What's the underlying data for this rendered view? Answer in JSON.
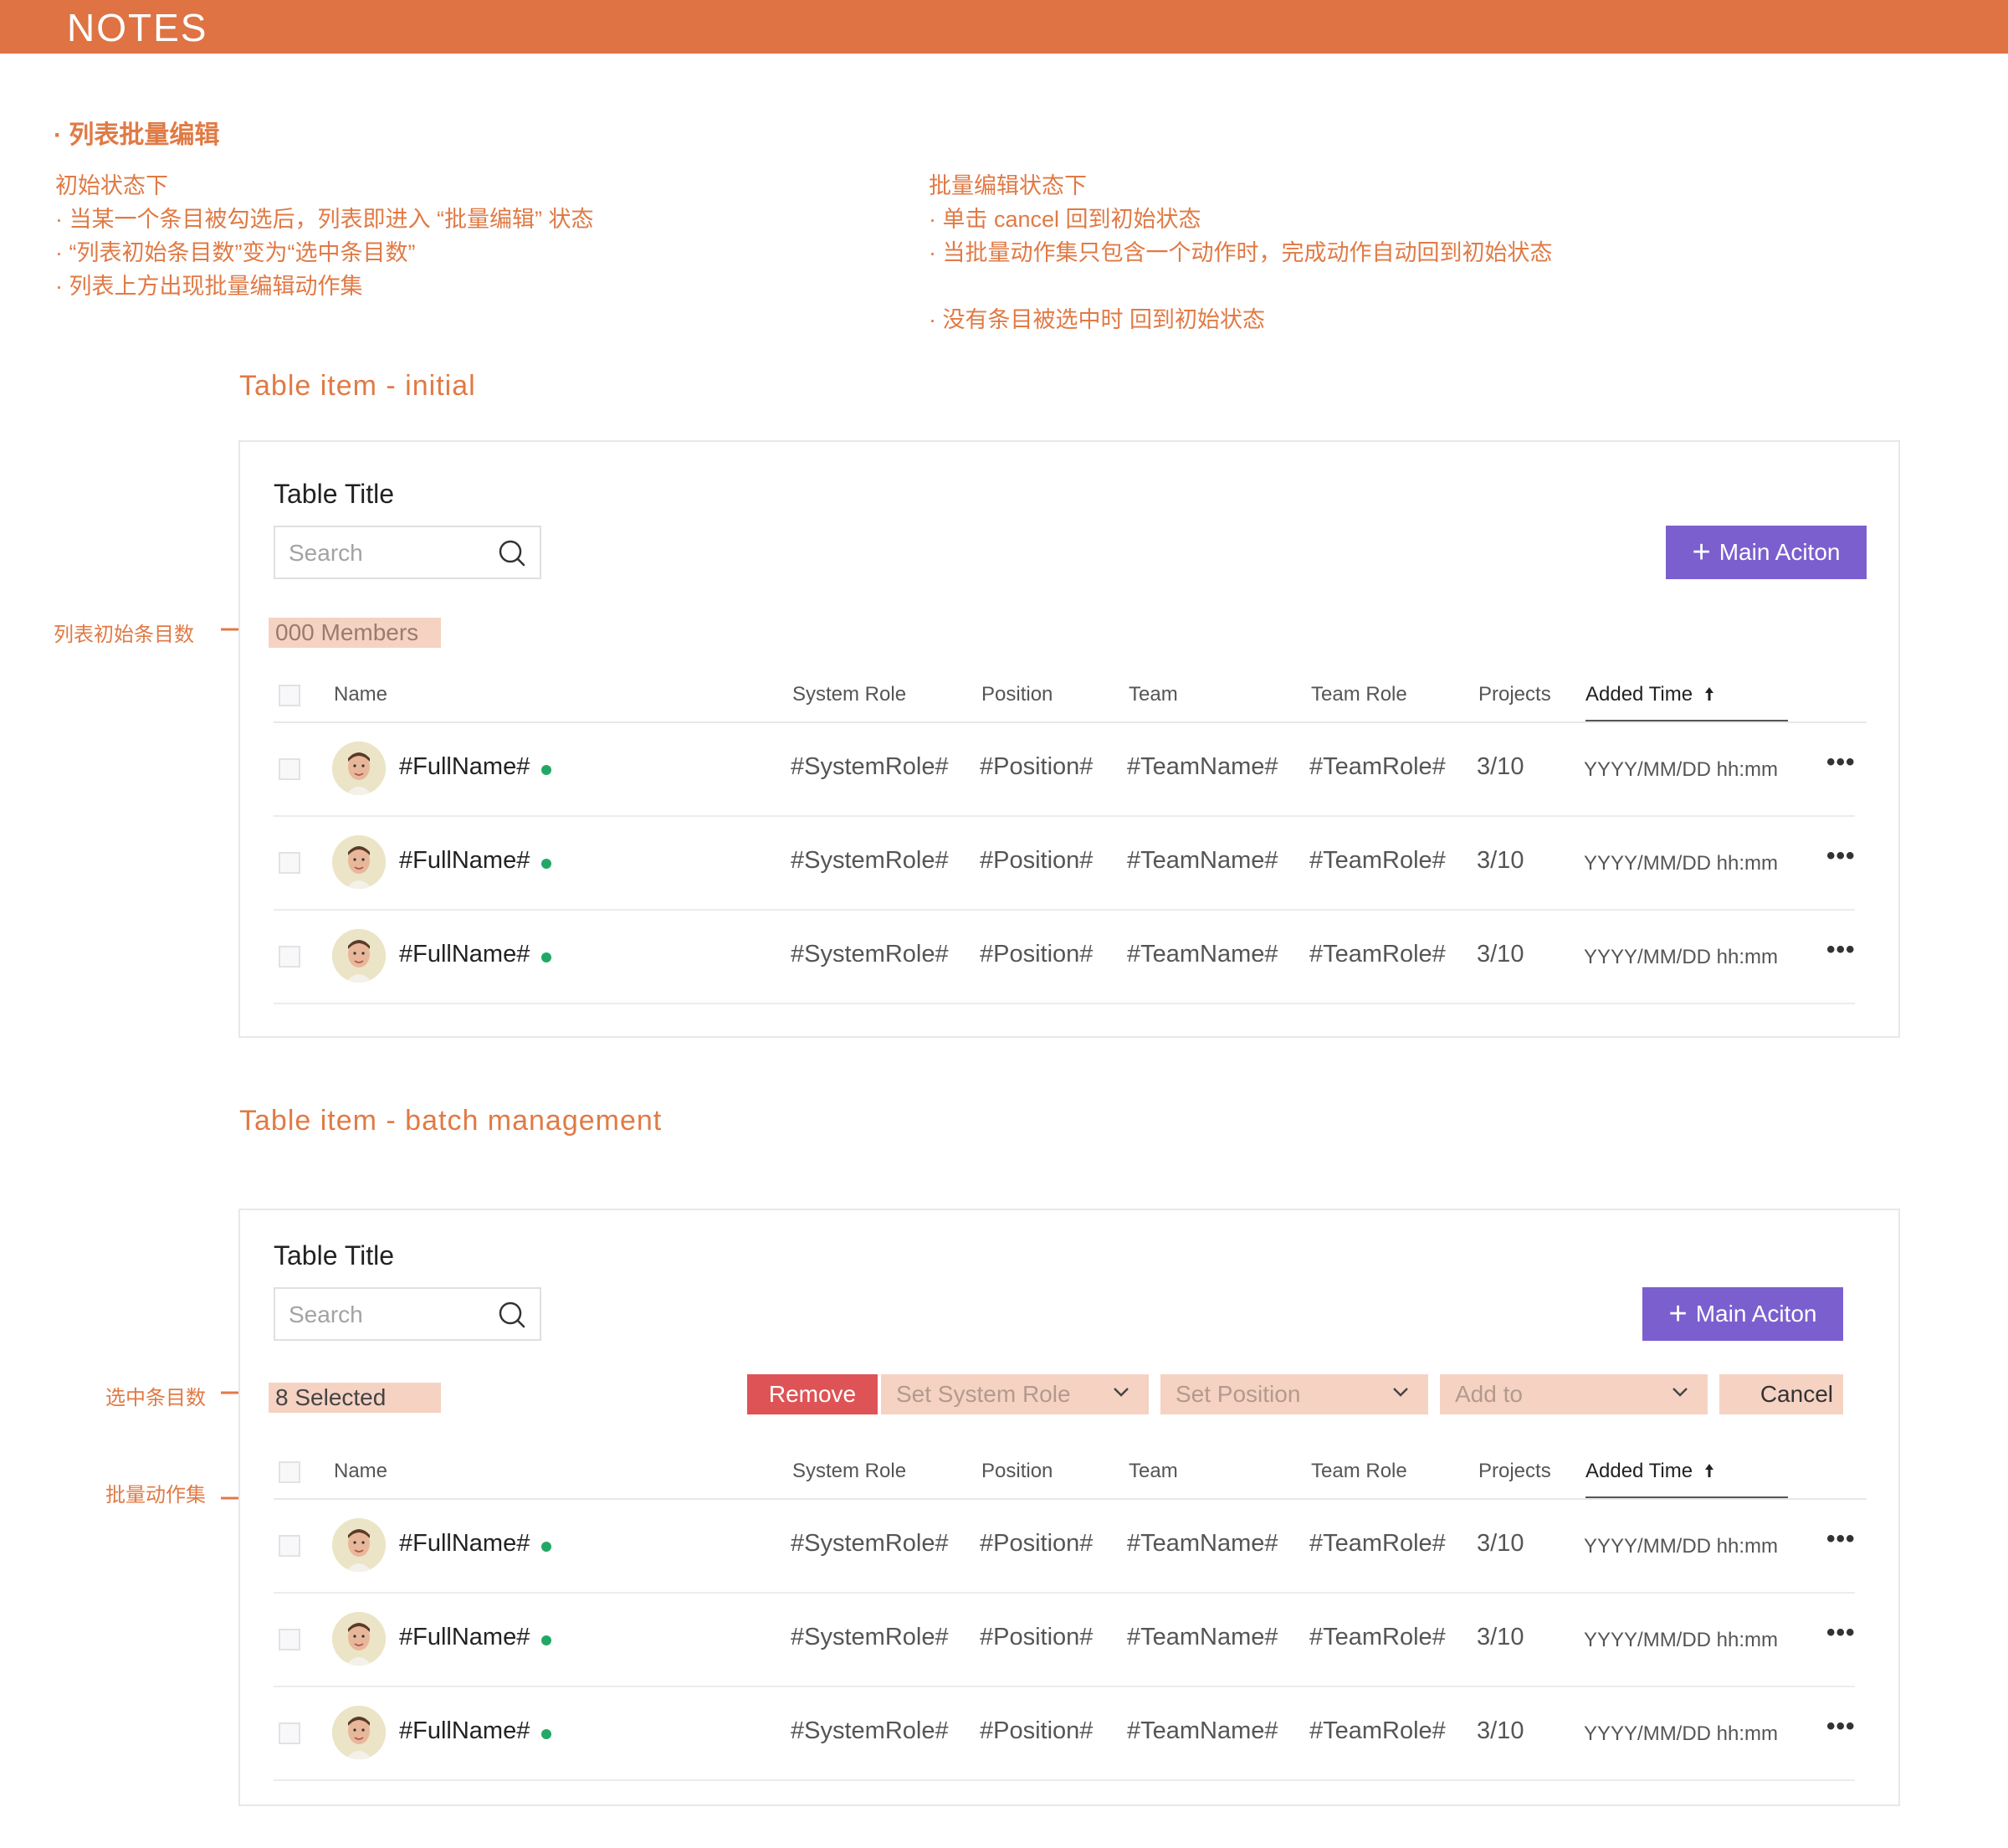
{
  "header": {
    "title": "NOTES"
  },
  "notes": {
    "heading": "· 列表批量编辑",
    "left": {
      "title": "初始状态下",
      "items": [
        "· 当某一个条目被勾选后，列表即进入 “批量编辑” 状态",
        "· “列表初始条目数”变为“选中条目数”",
        "· 列表上方出现批量编辑动作集"
      ]
    },
    "right": {
      "title": "批量编辑状态下",
      "items": [
        "· 单击 cancel 回到初始状态",
        "· 当批量动作集只包含一个动作时，完成动作自动回到初始状态",
        "· 没有条目被选中时 回到初始状态"
      ]
    }
  },
  "section1": {
    "title": "Table item - initial",
    "side_label": "列表初始条目数",
    "table_title": "Table Title",
    "search_placeholder": "Search",
    "main_action": "Main Aciton",
    "count": "000 Members"
  },
  "section2": {
    "title": "Table item - batch management",
    "side_label_selected": "选中条目数",
    "side_label_actions": "批量动作集",
    "table_title": "Table Title",
    "search_placeholder": "Search",
    "main_action": "Main Aciton",
    "count": "8 Selected",
    "actions": {
      "remove": "Remove",
      "set_system_role": "Set System Role",
      "set_position": "Set Position",
      "add_to": "Add to",
      "cancel": "Cancel"
    }
  },
  "columns": {
    "name": "Name",
    "system_role": "System Role",
    "position": "Position",
    "team": "Team",
    "team_role": "Team Role",
    "projects": "Projects",
    "added_time": "Added Time",
    "sort_icon": "arrow-up-icon"
  },
  "row": {
    "full_name": "#FullName#",
    "system_role": "#SystemRole#",
    "position": "#Position#",
    "team": "#TeamName#",
    "team_role": "#TeamRole#",
    "projects": "3/10",
    "added_time": "YYYY/MM/DD hh:mm",
    "more": "•••"
  },
  "colors": {
    "accent": "#e07a45",
    "header_bar": "#df7343",
    "primary_button": "#7b5fcf",
    "danger": "#de5456",
    "highlight": "#f6d2c3",
    "online_dot": "#22a866"
  }
}
